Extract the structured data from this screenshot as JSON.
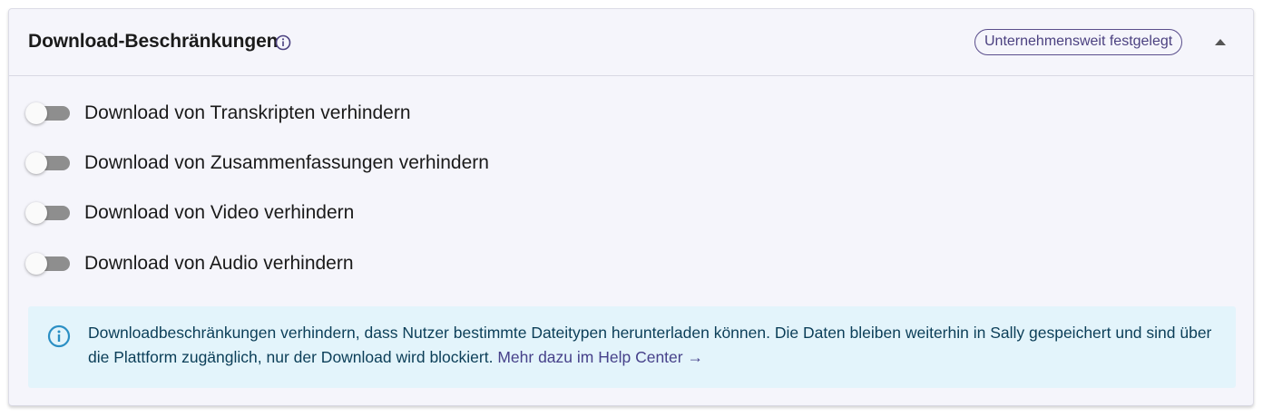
{
  "section": {
    "title": "Download-Beschränkungen",
    "badge": "Unternehmensweit festgelegt"
  },
  "toggles": [
    {
      "label": "Download von Transkripten verhindern",
      "enabled": false
    },
    {
      "label": "Download von Zusammenfassungen verhindern",
      "enabled": false
    },
    {
      "label": "Download von Video verhindern",
      "enabled": false
    },
    {
      "label": "Download von Audio verhindern",
      "enabled": false
    }
  ],
  "notice": {
    "text": "Downloadbeschränkungen verhindern, dass Nutzer bestimmte Dateitypen herunterladen können. Die Daten bleiben weiterhin in Sally gespeichert und sind über die Plattform zugänglich, nur der Download wird blockiert.",
    "link": "Mehr dazu im Help Center →"
  },
  "colors": {
    "card_background": "#f5f5fb",
    "badge_border": "#5a4e8c",
    "notice_background": "#e3f4fb",
    "notice_text": "#0b3e58",
    "notice_icon": "#2b8fc4",
    "toggle_track_off": "#8e8e8e"
  },
  "icons": {
    "title_info": "info-circle-icon",
    "collapse": "triangle-up-icon",
    "notice_info": "info-circle-icon"
  }
}
